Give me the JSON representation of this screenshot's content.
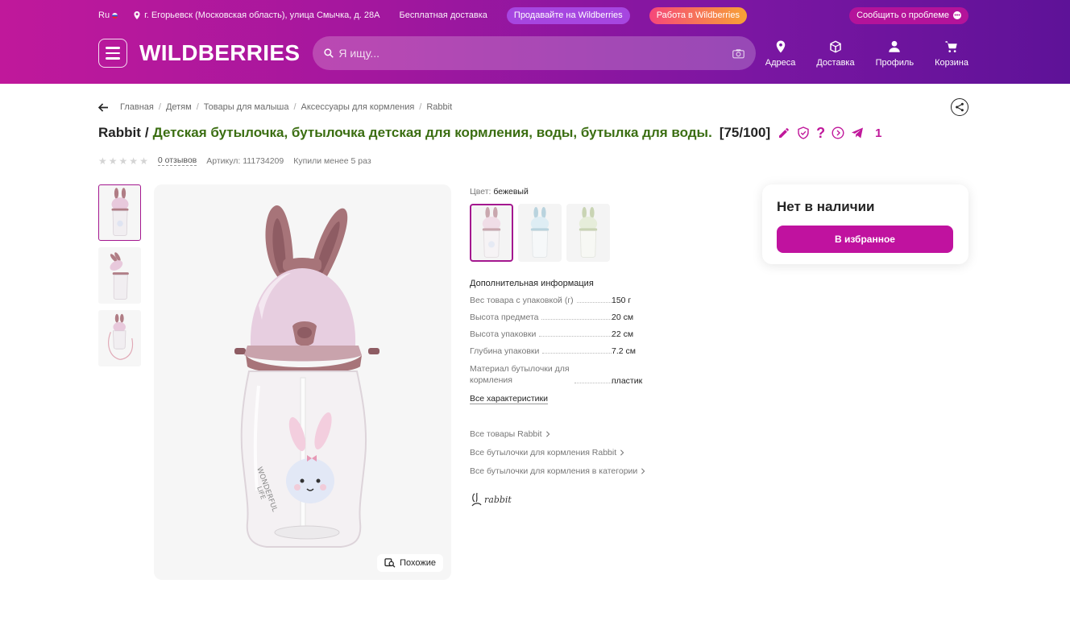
{
  "header": {
    "lang": "Ru",
    "address": "г. Егорьевск (Московская область), улица Смычка, д. 28А",
    "free_delivery": "Бесплатная доставка",
    "sell_pill": "Продавайте на Wildberries",
    "job_pill": "Работа в Wildberries",
    "report_pill": "Сообщить о проблеме",
    "logo": "WILDBERRIES",
    "search_placeholder": "Я ищу...",
    "nav": {
      "addresses": "Адреса",
      "delivery": "Доставка",
      "profile": "Профиль",
      "cart": "Корзина"
    }
  },
  "breadcrumbs": [
    "Главная",
    "Детям",
    "Товары для малыша",
    "Аксессуары для кормления",
    "Rabbit"
  ],
  "product": {
    "brand": "Rabbit",
    "name": "Детская бутылочка, бутылочка детская для кормления, воды, бутылка для воды.",
    "score": "[75/100]",
    "counter": "1",
    "reviews": "0 отзывов",
    "article": "Артикул: 111734209",
    "bought": "Купили менее 5 раз",
    "rating_stars": 0,
    "similar": "Похожие",
    "color_label": "Цвет:",
    "color_value": "бежевый",
    "info_title": "Дополнительная информация",
    "params": [
      {
        "k": "Вес товара с упаковкой (г)",
        "v": "150 г"
      },
      {
        "k": "Высота предмета",
        "v": "20 см"
      },
      {
        "k": "Высота упаковки",
        "v": "22 см"
      },
      {
        "k": "Глубина упаковки",
        "v": "7.2 см"
      },
      {
        "k": "Материал бутылочки для кормления",
        "v": "пластик"
      }
    ],
    "all_chars": "Все характеристики",
    "links": [
      "Все товары Rabbit",
      "Все бутылочки для кормления Rabbit",
      "Все бутылочки для кормления в категории"
    ],
    "brand_logo_text": "rabbit"
  },
  "buybox": {
    "status": "Нет в наличии",
    "fav_button": "В избранное"
  },
  "colors": {
    "accent": "#c0129f",
    "green_title": "#3b6e12"
  }
}
